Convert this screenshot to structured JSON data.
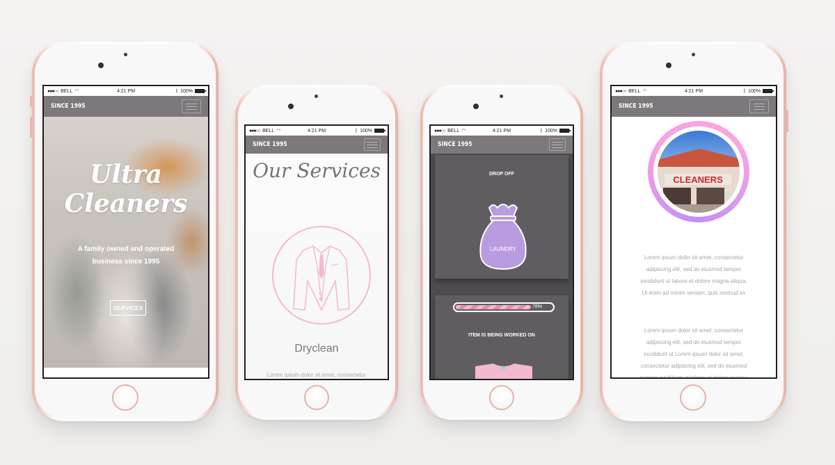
{
  "status_bar": {
    "carrier": "BELL",
    "time": "4:21 PM",
    "battery": "100%"
  },
  "navbar": {
    "brand": "SINCE 1995",
    "menu_icon": "hamburger-icon"
  },
  "screen1": {
    "title_line1": "Ultra",
    "title_line2": "Cleaners",
    "subtitle_line1": "A family owned and operated",
    "subtitle_line2": "business since 1995",
    "button_label": "SERVICES"
  },
  "screen2": {
    "title": "Our Services",
    "service_icon": "suit-icon",
    "service_name": "Dryclean",
    "description_peek": "Lorem ipsum dolor sit amet, consectetur"
  },
  "screen3": {
    "step1_label": "DROP OFF",
    "bag_label": "LAUNDRY",
    "progress_value": 0.78,
    "progress_text": "78%",
    "step2_label": "ITEM IS BEING WORKED ON"
  },
  "screen4": {
    "photo_sign": "CLEANERS",
    "paragraph1": [
      "Lorem ipsum dolor sit amet, consectetur",
      "adipiscing elit, sed do eiusmod tempor",
      "incididunt ut labore et dolore magna aliqua.",
      "Ut enim ad minim veniam, quis nostrud ex"
    ],
    "paragraph2": [
      "Lorem ipsum dolor sit amet, consectetur",
      "adipiscing elit, sed do eiusmod tempor",
      "incididunt ut Lorem ipsum dolor sit amet,",
      "consectetur adipiscing elit, sed do eiusmod",
      "tempor incididunt ut labore et dolore magna"
    ]
  },
  "colors": {
    "navbar": "#7d787b",
    "accent_pink": "#f2b9d0",
    "accent_purple": "#b99be0",
    "card_gray": "#605d60",
    "phone_rose": "#e5b9ae"
  }
}
